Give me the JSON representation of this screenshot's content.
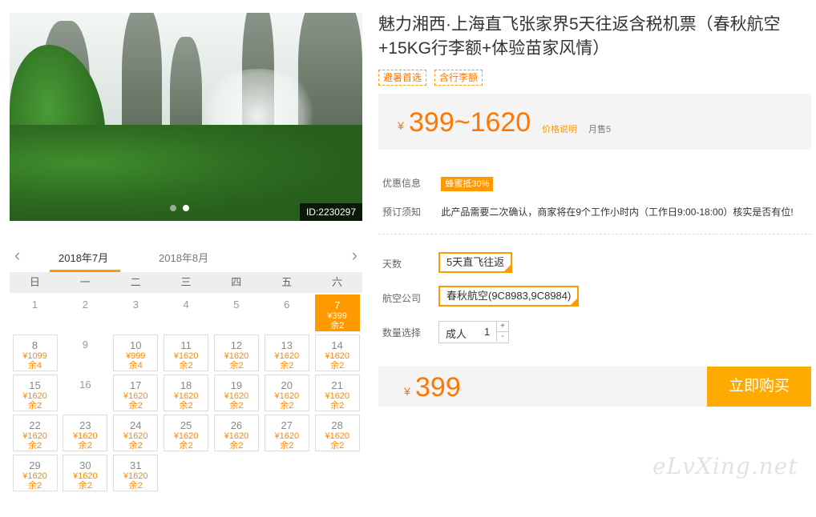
{
  "photo": {
    "id_badge": "ID:2230297",
    "slides": 2,
    "active_slide": 2
  },
  "calendar": {
    "prev_icon": "chevron-left-icon",
    "next_icon": "chevron-right-icon",
    "months": [
      "2018年7月",
      "2018年8月"
    ],
    "active_month": 0,
    "weekdays": [
      "日",
      "一",
      "二",
      "三",
      "四",
      "五",
      "六"
    ],
    "days": [
      {
        "d": "1"
      },
      {
        "d": "2"
      },
      {
        "d": "3"
      },
      {
        "d": "4"
      },
      {
        "d": "5"
      },
      {
        "d": "6"
      },
      {
        "d": "7",
        "price": "¥399",
        "stock": "余2",
        "selected": true
      },
      {
        "d": "8",
        "price": "¥1099",
        "stock": "余4"
      },
      {
        "d": "9"
      },
      {
        "d": "10",
        "price": "¥999",
        "stock": "余4"
      },
      {
        "d": "11",
        "price": "¥1620",
        "stock": "余2"
      },
      {
        "d": "12",
        "price": "¥1620",
        "stock": "余2"
      },
      {
        "d": "13",
        "price": "¥1620",
        "stock": "余2"
      },
      {
        "d": "14",
        "price": "¥1620",
        "stock": "余2"
      },
      {
        "d": "15",
        "price": "¥1620",
        "stock": "余2"
      },
      {
        "d": "16"
      },
      {
        "d": "17",
        "price": "¥1620",
        "stock": "余2"
      },
      {
        "d": "18",
        "price": "¥1620",
        "stock": "余2"
      },
      {
        "d": "19",
        "price": "¥1620",
        "stock": "余2"
      },
      {
        "d": "20",
        "price": "¥1620",
        "stock": "余2"
      },
      {
        "d": "21",
        "price": "¥1620",
        "stock": "余2"
      },
      {
        "d": "22",
        "price": "¥1620",
        "stock": "余2"
      },
      {
        "d": "23",
        "price": "¥1620",
        "stock": "余2"
      },
      {
        "d": "24",
        "price": "¥1620",
        "stock": "余2"
      },
      {
        "d": "25",
        "price": "¥1620",
        "stock": "余2"
      },
      {
        "d": "26",
        "price": "¥1620",
        "stock": "余2"
      },
      {
        "d": "27",
        "price": "¥1620",
        "stock": "余2"
      },
      {
        "d": "28",
        "price": "¥1620",
        "stock": "余2"
      },
      {
        "d": "29",
        "price": "¥1620",
        "stock": "余2"
      },
      {
        "d": "30",
        "price": "¥1620",
        "stock": "余2"
      },
      {
        "d": "31",
        "price": "¥1620",
        "stock": "余2"
      }
    ]
  },
  "product": {
    "title": "魅力湘西·上海直飞张家界5天往返含税机票（春秋航空+15KG行李额+体验苗家风情）",
    "tags": [
      "避暑首选",
      "含行李额"
    ],
    "price_symbol": "¥",
    "price_range": "399~1620",
    "price_note": "价格说明",
    "monthly_sales": "月售5"
  },
  "info": {
    "discount_label": "优惠信息",
    "discount_badge": "蜂蜜抵30%",
    "notice_label": "预订须知",
    "notice_text": "此产品需要二次确认，商家将在9个工作小时内（工作日9:00-18:00）核实是否有位!"
  },
  "options": {
    "days_label": "天数",
    "days_value": "5天直飞往返",
    "airline_label": "航空公司",
    "airline_value": "春秋航空(9C8983,9C8984)",
    "qty_label": "数量选择",
    "qty_type": "成人",
    "qty_value": "1",
    "plus": "+",
    "minus": "-"
  },
  "buy": {
    "price_symbol": "¥",
    "price": "399",
    "button": "立即购买"
  },
  "watermark": "eLvXing.net",
  "colors": {
    "accent": "#ff9900",
    "price": "#ff7700",
    "button": "#ffaa00"
  }
}
